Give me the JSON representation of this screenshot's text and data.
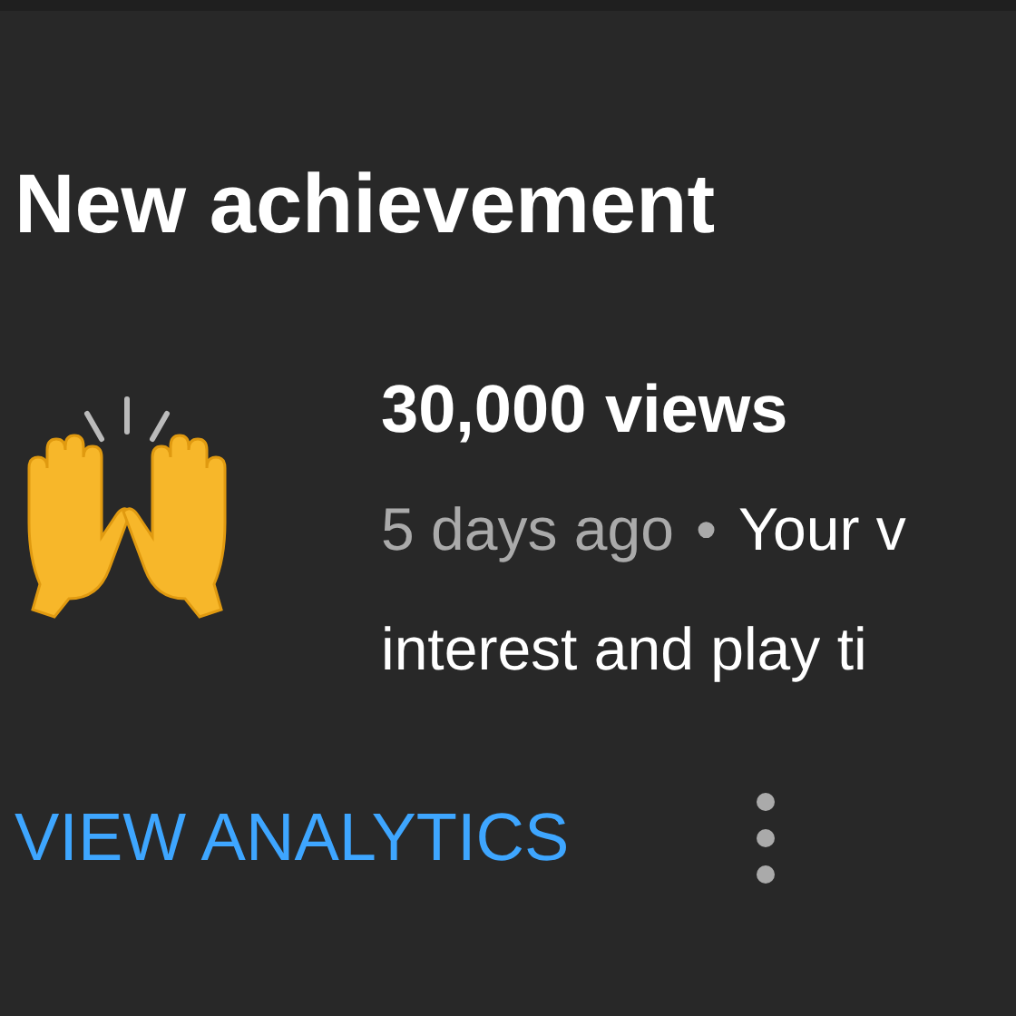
{
  "title": "New achievement",
  "achievement": {
    "heading": "30,000 views",
    "time": "5 days ago",
    "separator": "•",
    "description_line_1": "Your v",
    "description_line_2": "interest and play ti"
  },
  "action": {
    "label": "VIEW ANALYTICS"
  }
}
